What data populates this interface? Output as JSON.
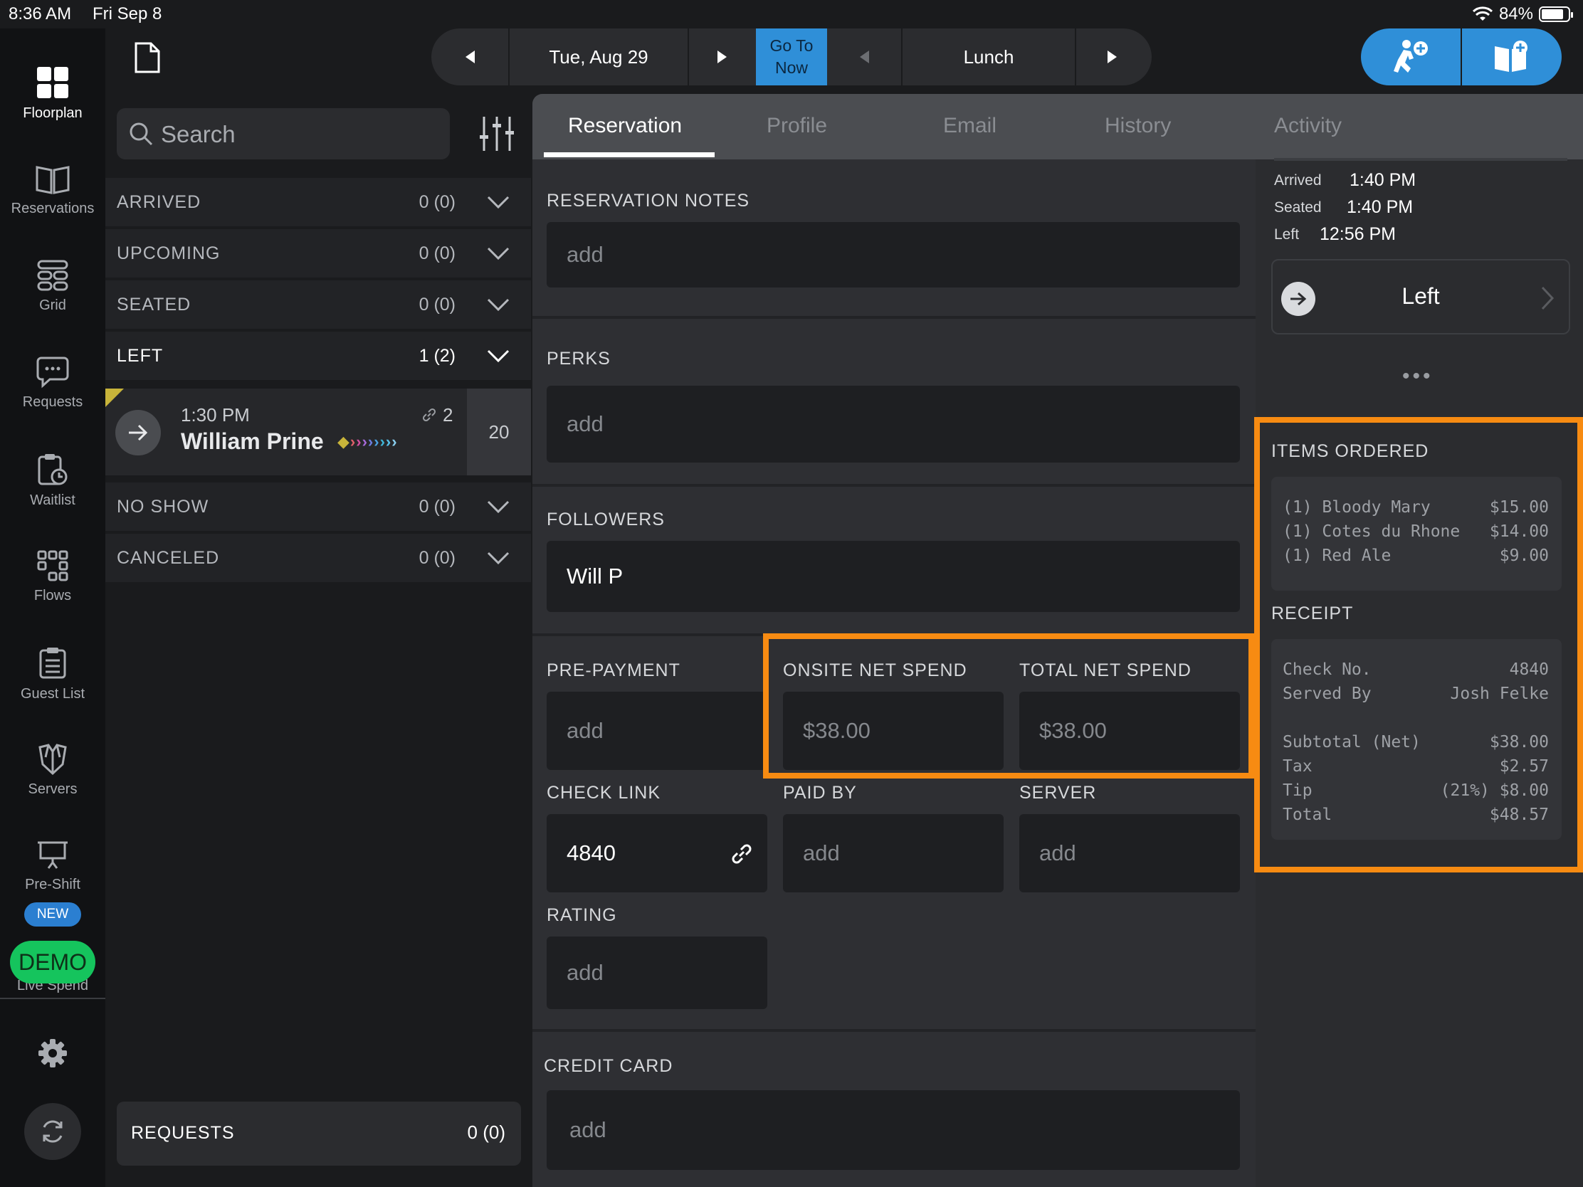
{
  "status_bar": {
    "time": "8:36 AM",
    "date": "Fri Sep 8",
    "battery": "84%",
    "battery_level": 0.84
  },
  "left_nav": {
    "items": [
      {
        "label": "Floorplan",
        "icon": "grid-squares-icon"
      },
      {
        "label": "Reservations",
        "icon": "book-icon"
      },
      {
        "label": "Grid",
        "icon": "table-grid-icon"
      },
      {
        "label": "Requests",
        "icon": "chat-bubble-icon"
      },
      {
        "label": "Waitlist",
        "icon": "clipboard-clock-icon"
      },
      {
        "label": "Flows",
        "icon": "flows-icon"
      },
      {
        "label": "Guest List",
        "icon": "list-icon"
      },
      {
        "label": "Servers",
        "icon": "server-icon"
      },
      {
        "label": "Pre-Shift",
        "icon": "presentation-icon"
      }
    ],
    "new_badge": "NEW",
    "demo_badge": "DEMO",
    "demo_sub": "Live Spend"
  },
  "topbar": {
    "date": "Tue, Aug 29",
    "go_to_now": "Go To Now",
    "shift": "Lunch",
    "accent": "#2f8fd8"
  },
  "list": {
    "search_placeholder": "Search",
    "groups": [
      {
        "label": "ARRIVED",
        "count": "0 (0)"
      },
      {
        "label": "UPCOMING",
        "count": "0 (0)"
      },
      {
        "label": "SEATED",
        "count": "0 (0)"
      },
      {
        "label": "LEFT",
        "count": "1 (2)"
      },
      {
        "label": "NO SHOW",
        "count": "0 (0)"
      },
      {
        "label": "CANCELED",
        "count": "0 (0)"
      }
    ],
    "reservation": {
      "time": "1:30 PM",
      "name": "William Prine",
      "party": "2",
      "table": "20"
    },
    "requests": {
      "label": "REQUESTS",
      "count": "0 (0)"
    }
  },
  "tabs": [
    "Reservation",
    "Profile",
    "Email",
    "History",
    "Activity"
  ],
  "form": {
    "reservation_notes": {
      "label": "RESERVATION NOTES",
      "placeholder": "add"
    },
    "perks": {
      "label": "PERKS",
      "placeholder": "add"
    },
    "followers": {
      "label": "FOLLOWERS",
      "value": "Will P"
    },
    "pre_payment": {
      "label": "PRE-PAYMENT",
      "placeholder": "add"
    },
    "onsite_net_spend": {
      "label": "ONSITE NET SPEND",
      "value": "$38.00"
    },
    "total_net_spend": {
      "label": "TOTAL NET SPEND",
      "value": "$38.00"
    },
    "check_link": {
      "label": "CHECK LINK",
      "value": "4840"
    },
    "paid_by": {
      "label": "PAID BY",
      "placeholder": "add"
    },
    "server": {
      "label": "SERVER",
      "placeholder": "add"
    },
    "rating": {
      "label": "RATING",
      "placeholder": "add"
    },
    "credit_card": {
      "label": "CREDIT CARD",
      "placeholder": "add"
    }
  },
  "side": {
    "arrived_label": "Arrived",
    "arrived": "1:40 PM",
    "seated_label": "Seated",
    "seated": "1:40 PM",
    "left_label": "Left",
    "left": "12:56 PM",
    "status_button": "Left",
    "items_title": "ITEMS ORDERED",
    "items": [
      {
        "item": "(1) Bloody Mary",
        "price": "$15.00"
      },
      {
        "item": "(1) Cotes du Rhone",
        "price": "$14.00"
      },
      {
        "item": "(1) Red Ale",
        "price": "$9.00"
      }
    ],
    "receipt_title": "RECEIPT",
    "receipt": {
      "check_no_label": "Check No.",
      "check_no": "4840",
      "served_by_label": "Served By",
      "served_by": "Josh Felke",
      "subtotal_label": "Subtotal (Net)",
      "subtotal": "$38.00",
      "tax_label": "Tax",
      "tax": "$2.57",
      "tip_label": "Tip",
      "tip": "(21%) $8.00",
      "total_label": "Total",
      "total": "$48.57"
    }
  },
  "highlight_color": "#f78b12"
}
